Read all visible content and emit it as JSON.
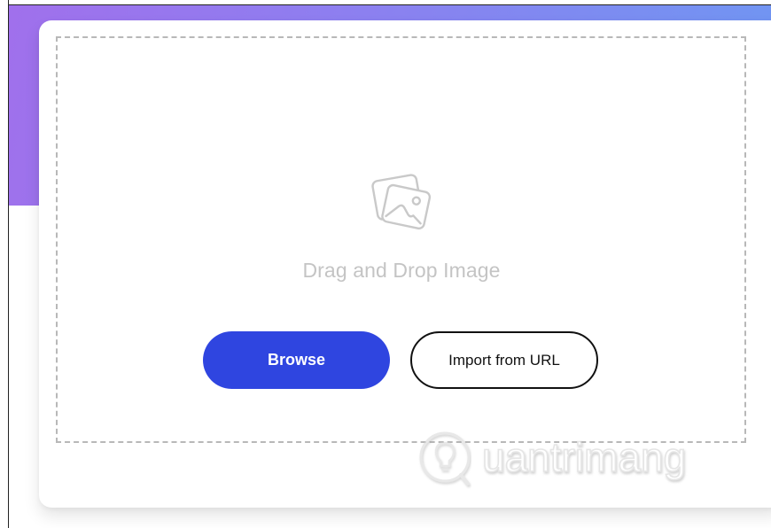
{
  "upload": {
    "drop_text": "Drag and Drop Image",
    "browse_label": "Browse",
    "import_label": "Import from URL",
    "icon": "image-icon"
  },
  "watermark": {
    "text": "Quantrimang"
  },
  "colors": {
    "banner_start": "#a070ec",
    "banner_end": "#6f96f2",
    "primary_button": "#2f45e0",
    "dropzone_border": "#b8b8b8",
    "drop_text": "#c4c4c4"
  }
}
